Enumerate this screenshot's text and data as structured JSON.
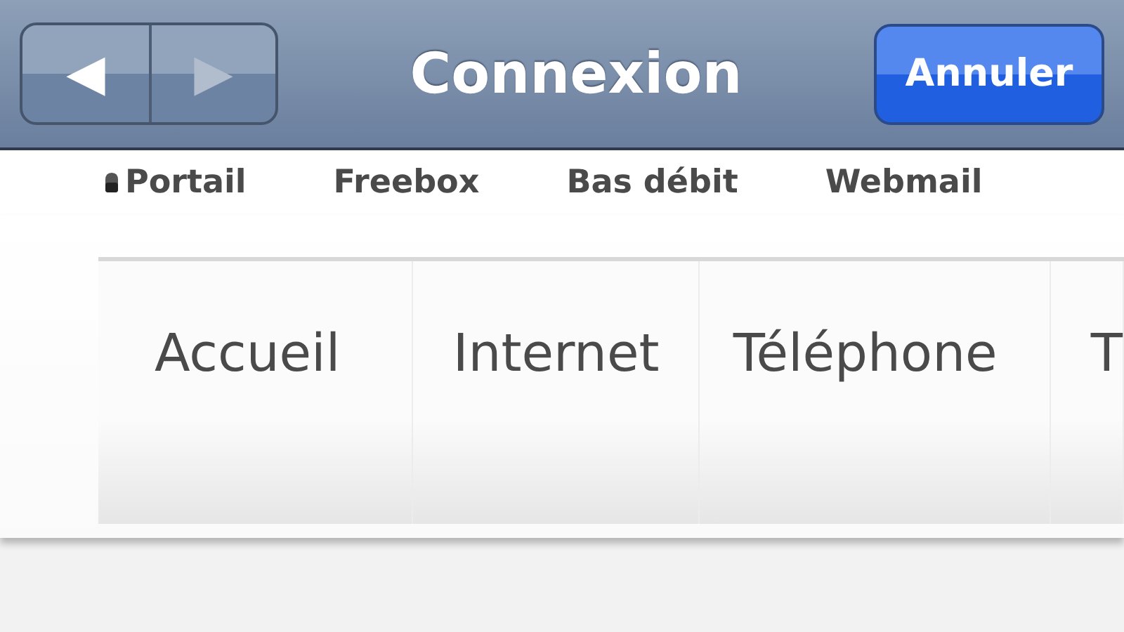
{
  "nav_bar": {
    "back": {
      "label": "◀",
      "disabled": false
    },
    "forward": {
      "label": "▶",
      "disabled": true
    },
    "title": "Connexion",
    "cancel": "Annuler"
  },
  "top_links": [
    {
      "label": "Portail",
      "icon": true
    },
    {
      "label": "Freebox",
      "icon": false
    },
    {
      "label": "Bas débit",
      "icon": false
    },
    {
      "label": "Webmail",
      "icon": false
    }
  ],
  "tabs": [
    {
      "label": "Accueil"
    },
    {
      "label": "Internet"
    },
    {
      "label": "Téléphone"
    },
    {
      "label": "T"
    }
  ]
}
